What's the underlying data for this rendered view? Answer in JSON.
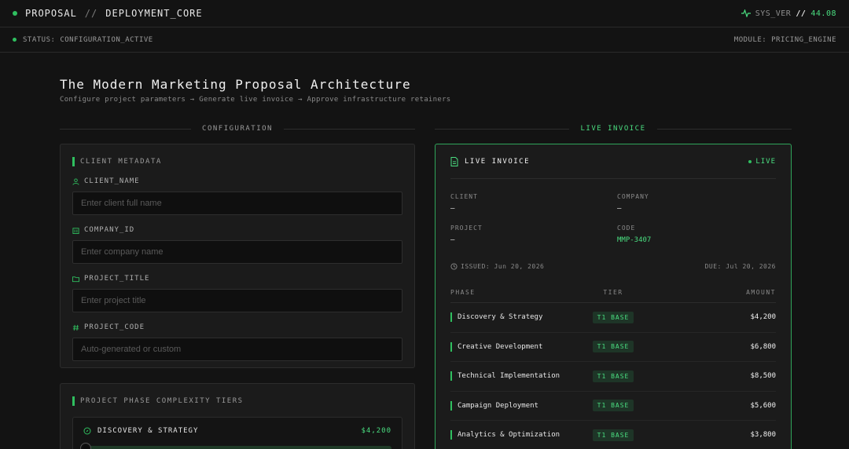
{
  "topbar": {
    "left_title": "PROPOSAL",
    "separator": "//",
    "right_title": "DEPLOYMENT_CORE",
    "sys_label": "SYS_VER",
    "sys_sep": "//",
    "sys_value": "44.08"
  },
  "statusbar": {
    "status": "STATUS: CONFIGURATION_ACTIVE",
    "module": "MODULE: PRICING_ENGINE"
  },
  "page": {
    "title": "The Modern Marketing Proposal Architecture",
    "subtitle": "Configure project parameters → Generate live invoice → Approve infrastructure retainers"
  },
  "sections": {
    "configuration": "CONFIGURATION",
    "invoice": "LIVE INVOICE"
  },
  "client_metadata": {
    "title": "CLIENT METADATA",
    "fields": [
      {
        "label": "CLIENT_NAME",
        "placeholder": "Enter client full name",
        "value": ""
      },
      {
        "label": "COMPANY_ID",
        "placeholder": "Enter company name",
        "value": ""
      },
      {
        "label": "PROJECT_TITLE",
        "placeholder": "Enter project title",
        "value": ""
      },
      {
        "label": "PROJECT_CODE",
        "placeholder": "Auto-generated or custom",
        "value": ""
      }
    ]
  },
  "tiers": {
    "title": "PROJECT PHASE COMPLEXITY TIERS",
    "first": {
      "name": "DISCOVERY & STRATEGY",
      "price": "$4,200",
      "level": 0
    }
  },
  "invoice": {
    "label": "LIVE INVOICE",
    "live": "LIVE",
    "client_label": "CLIENT",
    "client_value": "—",
    "company_label": "COMPANY",
    "company_value": "—",
    "project_label": "PROJECT",
    "project_value": "—",
    "code_label": "CODE",
    "code_value": "MMP-3407",
    "issued": "ISSUED: Jun 20, 2026",
    "due": "DUE: Jul 20, 2026",
    "columns": [
      "PHASE",
      "TIER",
      "AMOUNT"
    ],
    "rows": [
      {
        "phase": "Discovery & Strategy",
        "tier": "T1 BASE",
        "amount": "$4,200"
      },
      {
        "phase": "Creative Development",
        "tier": "T1 BASE",
        "amount": "$6,800"
      },
      {
        "phase": "Technical Implementation",
        "tier": "T1 BASE",
        "amount": "$8,500"
      },
      {
        "phase": "Campaign Deployment",
        "tier": "T1 BASE",
        "amount": "$5,600"
      },
      {
        "phase": "Analytics & Optimization",
        "tier": "T1 BASE",
        "amount": "$3,800"
      }
    ]
  }
}
